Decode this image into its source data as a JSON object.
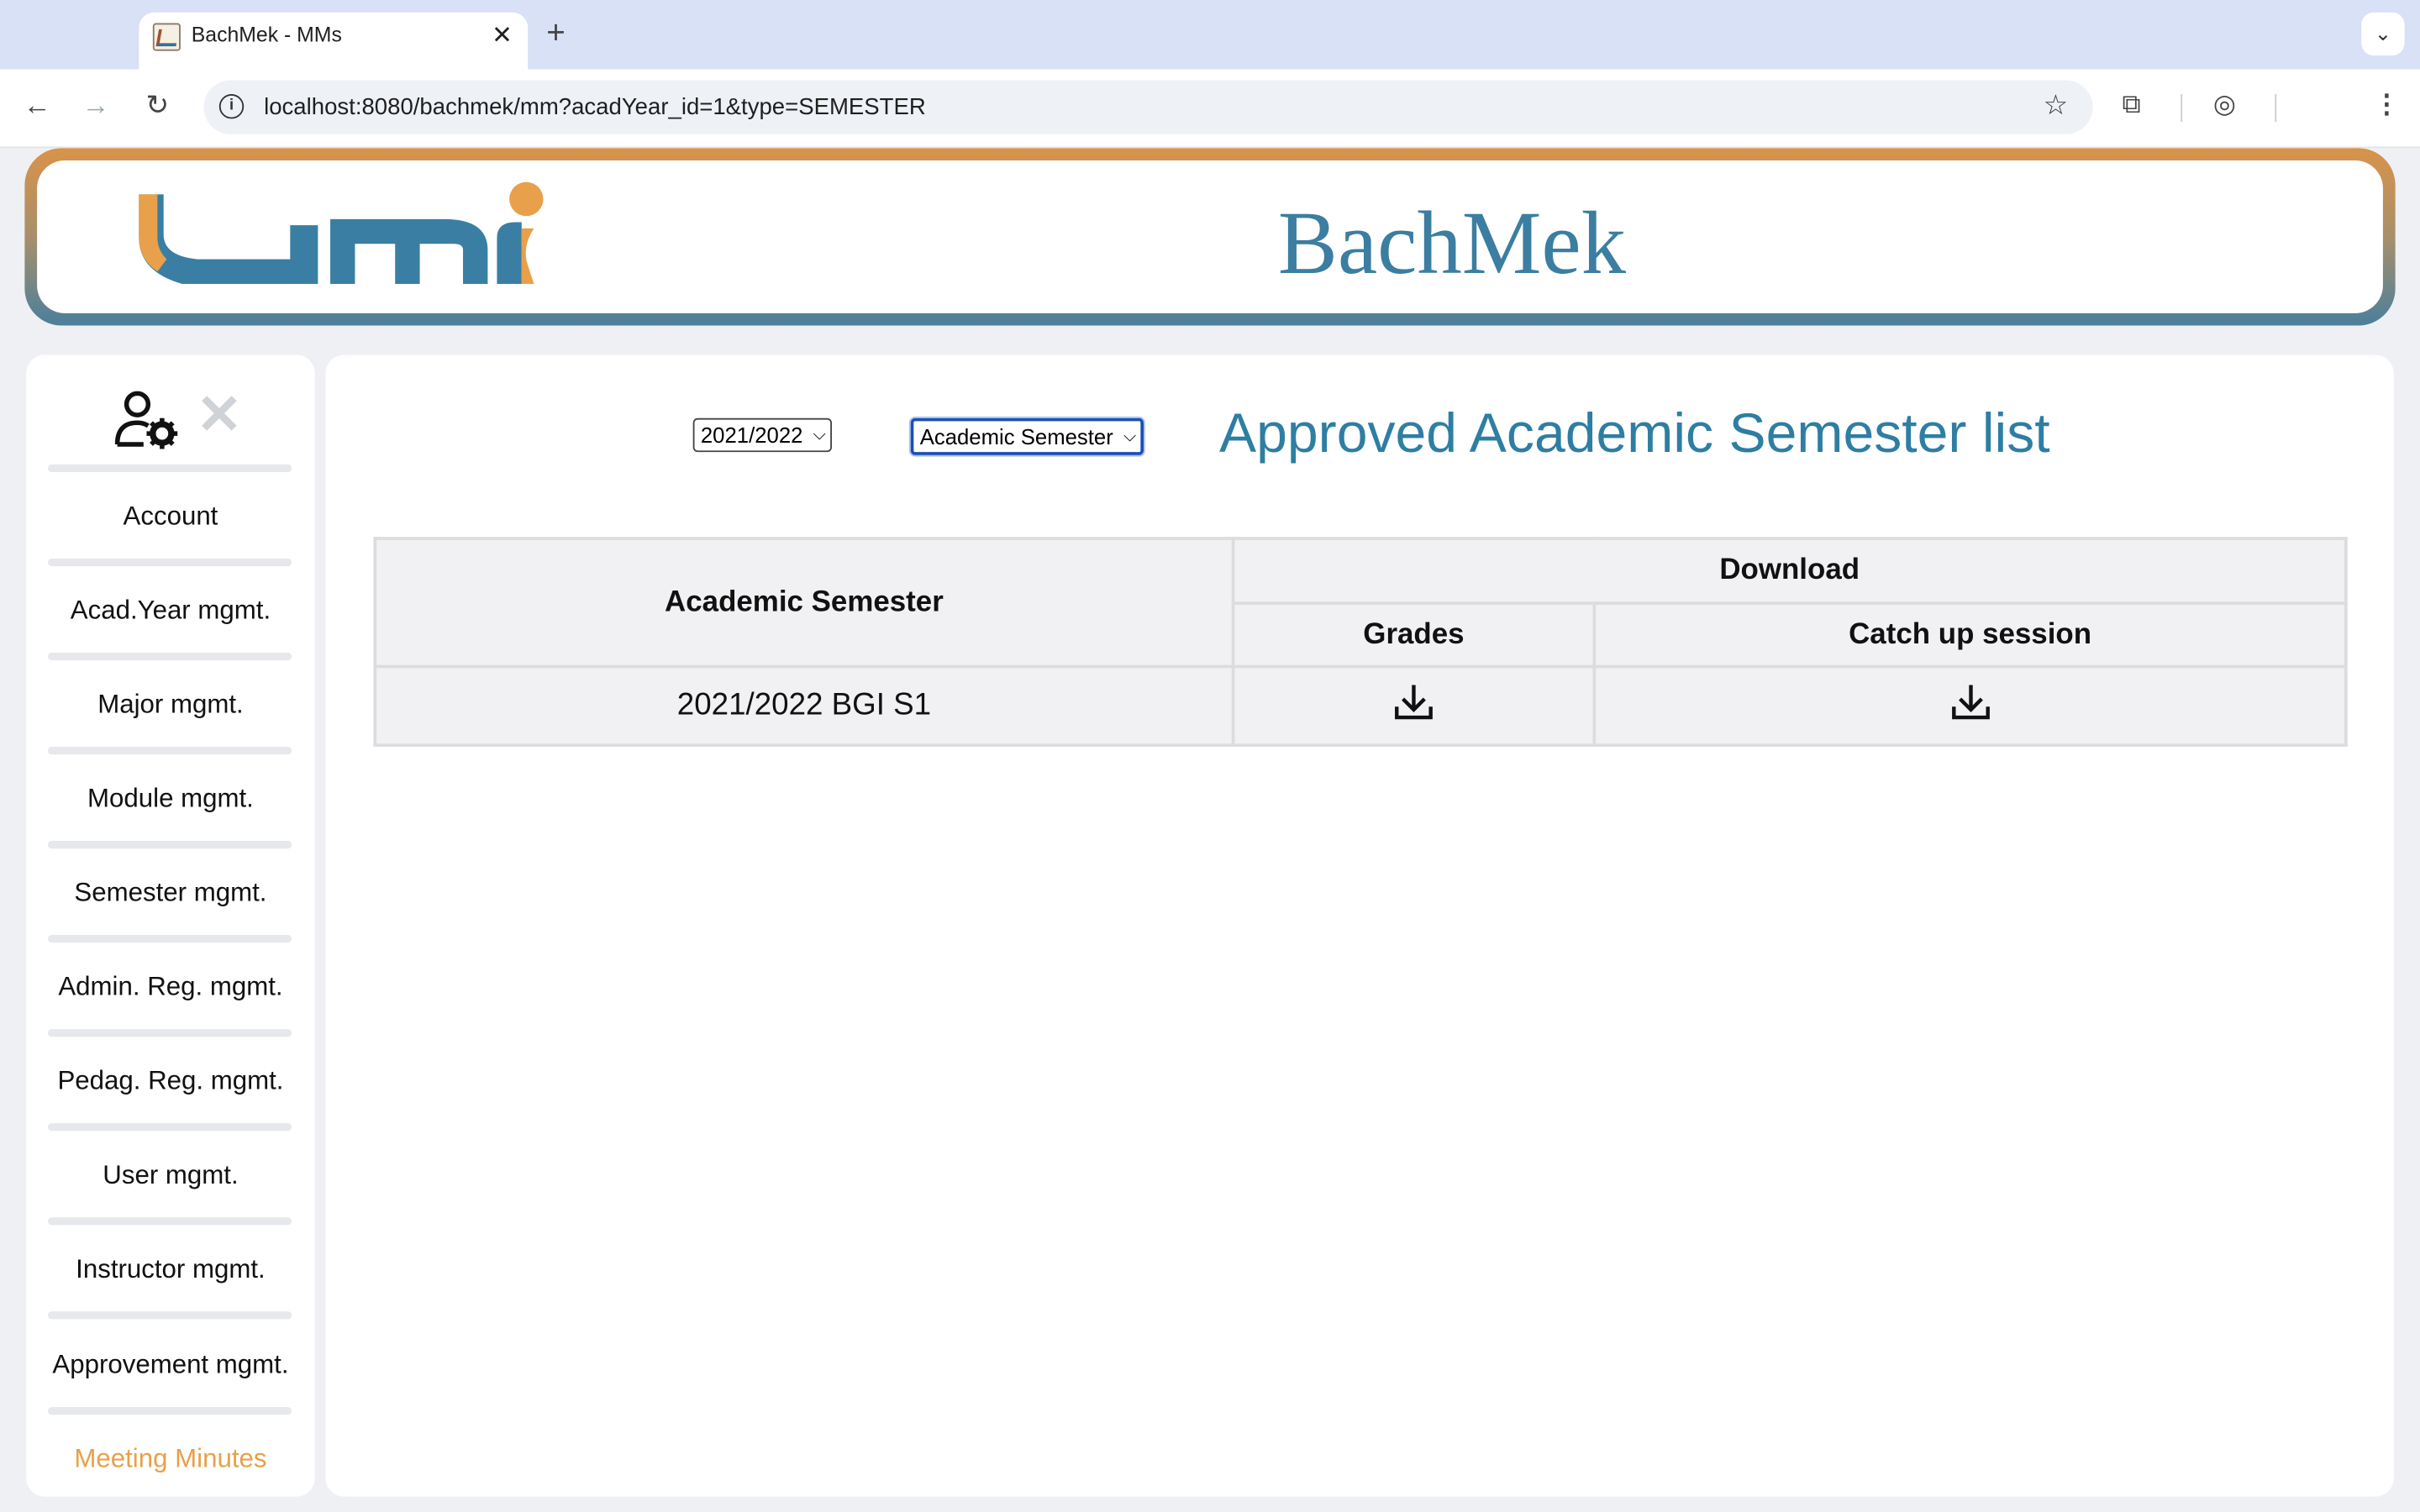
{
  "browser": {
    "tab_title": "BachMek - MMs",
    "url": "localhost:8080/bachmek/mm?acadYear_id=1&type=SEMESTER"
  },
  "header": {
    "site_title": "BachMek",
    "logo_icon": "umi-logo",
    "colors": {
      "orange": "#e8a04a",
      "blue": "#3b7ea1"
    }
  },
  "sidebar": {
    "items": [
      {
        "label": "Account"
      },
      {
        "label": "Acad.Year mgmt."
      },
      {
        "label": "Major mgmt."
      },
      {
        "label": "Module mgmt."
      },
      {
        "label": "Semester mgmt."
      },
      {
        "label": "Admin. Reg. mgmt."
      },
      {
        "label": "Pedag. Reg. mgmt."
      },
      {
        "label": "User mgmt."
      },
      {
        "label": "Instructor mgmt."
      },
      {
        "label": "Approvement mgmt."
      },
      {
        "label": "Meeting Minutes",
        "active": true
      }
    ]
  },
  "main": {
    "year_select": {
      "value": "2021/2022"
    },
    "type_select": {
      "value": "Academic Semester"
    },
    "heading": "Approved Academic Semester list",
    "table": {
      "col_semester": "Academic Semester",
      "col_download": "Download",
      "col_grades": "Grades",
      "col_catchup": "Catch up session",
      "rows": [
        {
          "semester": "2021/2022 BGI S1"
        }
      ]
    }
  }
}
